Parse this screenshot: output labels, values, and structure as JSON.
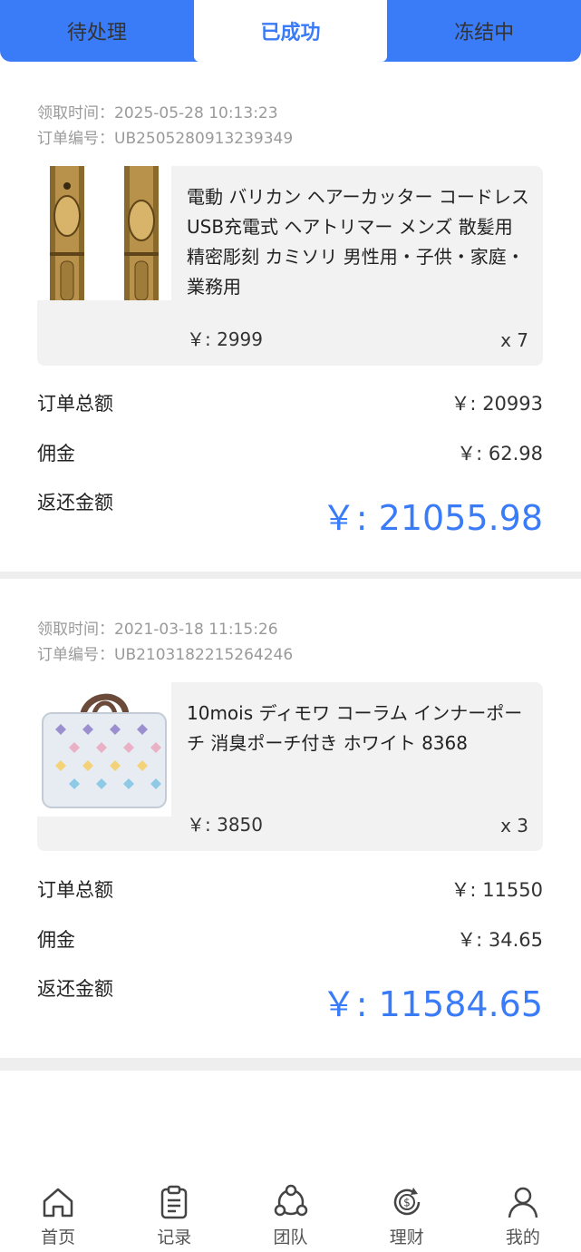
{
  "tabs": [
    {
      "label": "待处理",
      "active": false
    },
    {
      "label": "已成功",
      "active": true
    },
    {
      "label": "冻结中",
      "active": false
    }
  ],
  "labels": {
    "claim_time": "领取时间：",
    "order_no": "订单编号：",
    "order_total": "订单总额",
    "commission": "佣金",
    "refund_amount": "返还金额"
  },
  "orders": [
    {
      "claim_time": "2025-05-28 10:13:23",
      "order_no": "UB2505280913239349",
      "product_name": "電動 バリカン ヘアーカッター コードレス USB充電式 ヘアトリマー メンズ 散髪用 精密彫刻 カミソリ 男性用・子供・家庭・業務用",
      "price": "￥: 2999",
      "qty": "x 7",
      "order_total": "￥: 20993",
      "commission": "￥: 62.98",
      "refund_amount": "￥: 21055.98"
    },
    {
      "claim_time": "2021-03-18 11:15:26",
      "order_no": "UB2103182215264246",
      "product_name": "10mois ディモワ コーラム インナーポーチ 消臭ポーチ付き ホワイト 8368",
      "price": "￥: 3850",
      "qty": "x 3",
      "order_total": "￥: 11550",
      "commission": "￥: 34.65",
      "refund_amount": "￥: 11584.65"
    }
  ],
  "nav": [
    {
      "label": "首页",
      "icon": "home-icon"
    },
    {
      "label": "记录",
      "icon": "clipboard-icon"
    },
    {
      "label": "团队",
      "icon": "team-icon"
    },
    {
      "label": "理财",
      "icon": "finance-icon"
    },
    {
      "label": "我的",
      "icon": "user-icon"
    }
  ],
  "colors": {
    "accent": "#3a7bf7",
    "card_bg": "#f2f2f2",
    "muted": "#9a9a9a"
  }
}
